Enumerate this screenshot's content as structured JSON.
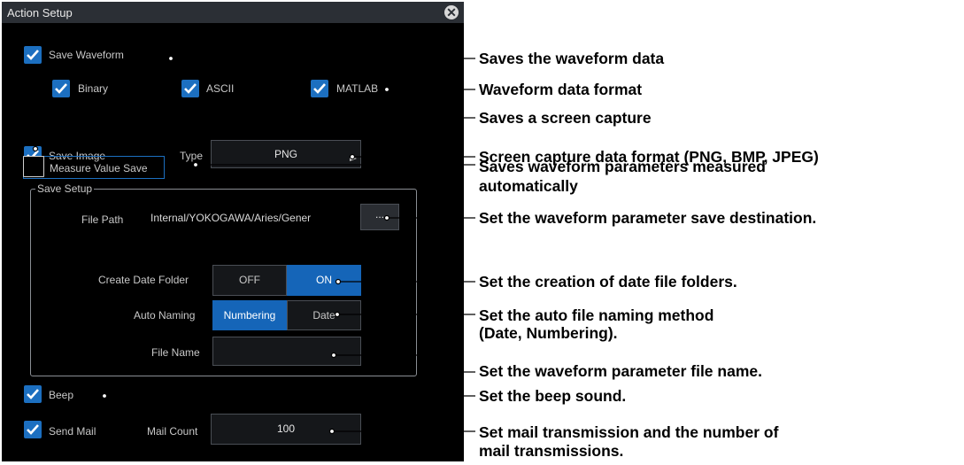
{
  "dialog": {
    "title": "Action Setup",
    "save_waveform": "Save Waveform",
    "formats": [
      "Binary",
      "ASCII",
      "MATLAB"
    ],
    "save_image": "Save Image",
    "type_label": "Type",
    "type_value": "PNG",
    "measure_value_save": "Measure Value Save",
    "save_setup": "Save Setup",
    "file_path_label": "File Path",
    "file_path_value": "Internal/YOKOGAWA/Aries/Gener",
    "browse": "...",
    "create_date_folder_label": "Create Date Folder",
    "off": "OFF",
    "on": "ON",
    "auto_naming_label": "Auto Naming",
    "numbering": "Numbering",
    "date": "Date",
    "file_name_label": "File Name",
    "file_name_value": "",
    "beep": "Beep",
    "send_mail": "Send Mail",
    "mail_count_label": "Mail Count",
    "mail_count_value": "100"
  },
  "annotations": [
    "Saves the waveform data",
    "Waveform data format",
    "Saves a screen capture",
    "Screen capture data format (PNG, BMP, JPEG)",
    "Saves waveform parameters measured",
    "automatically",
    "Set the waveform parameter save destination.",
    "Set the creation of date file folders.",
    "Set the auto file naming method",
    "(Date, Numbering).",
    "Set the waveform parameter file name.",
    "Set the beep sound.",
    "Set mail transmission and the number of",
    "mail transmissions."
  ]
}
